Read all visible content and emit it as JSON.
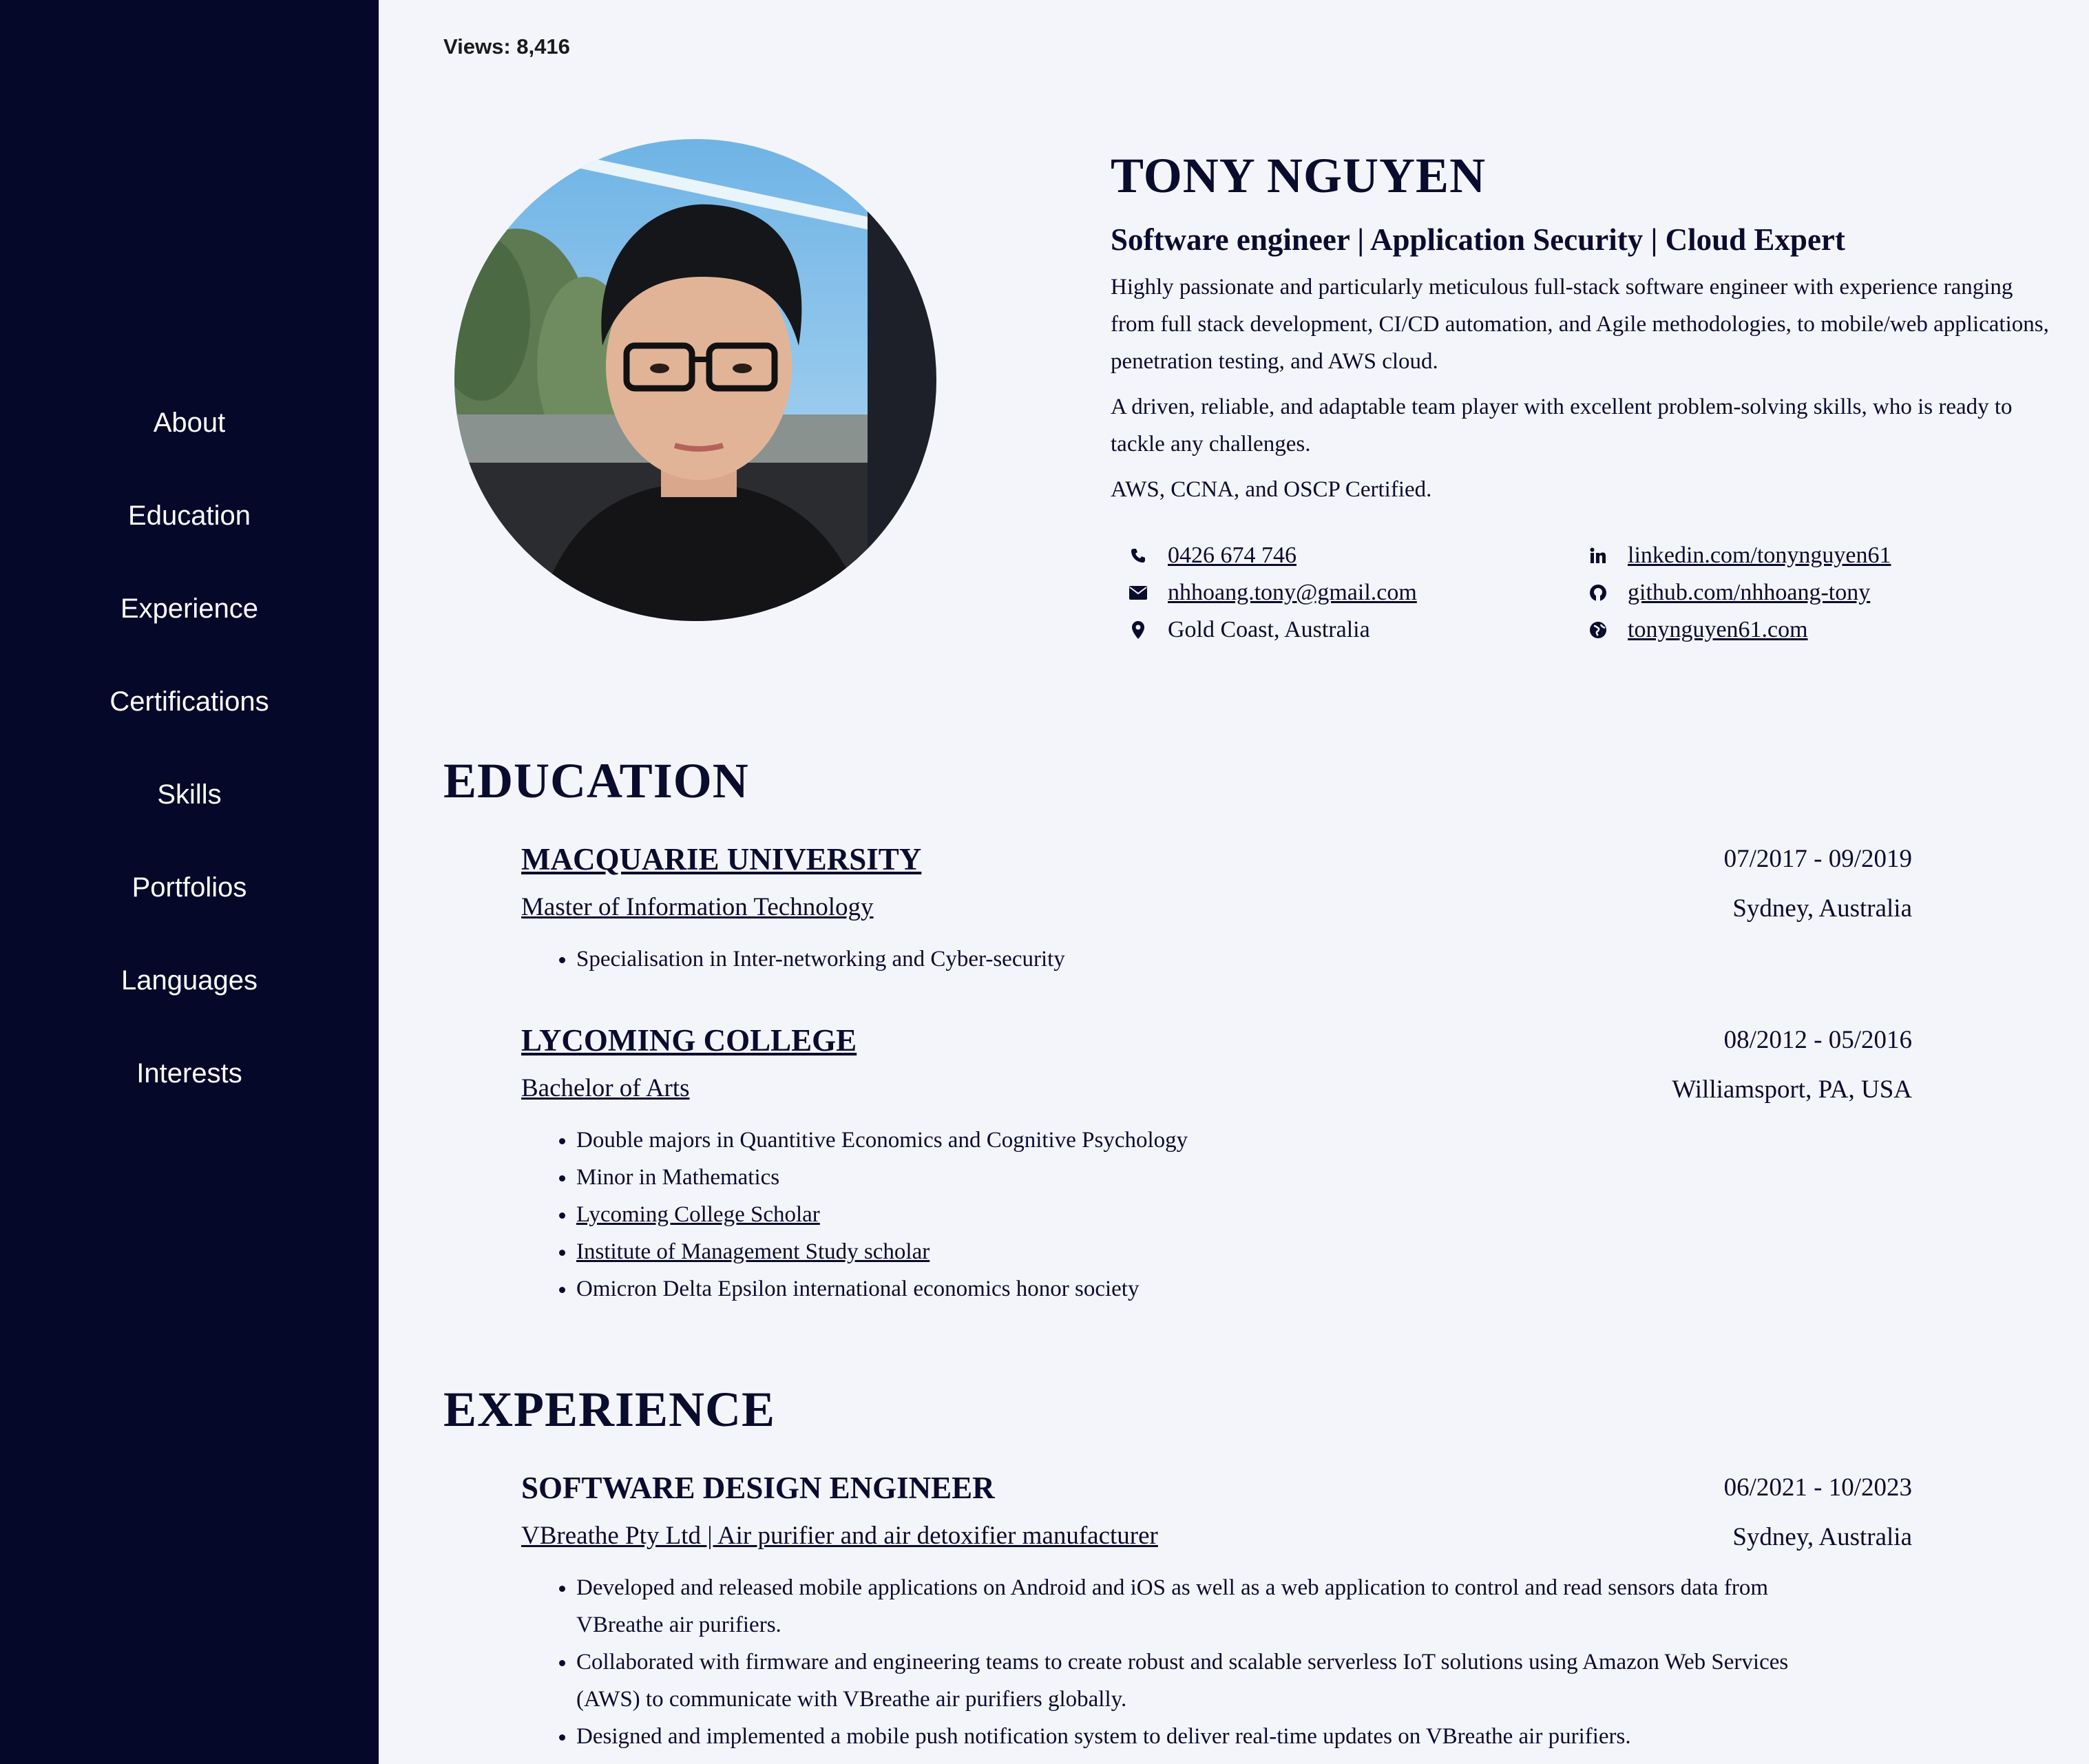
{
  "views": "Views: 8,416",
  "nav": [
    "About",
    "Education",
    "Experience",
    "Certifications",
    "Skills",
    "Portfolios",
    "Languages",
    "Interests"
  ],
  "profile": {
    "name": "TONY NGUYEN",
    "headline": "Software engineer | Application Security | Cloud Expert",
    "summary": [
      "Highly passionate and particularly meticulous full-stack software engineer with experience ranging from full stack development, CI/CD automation, and Agile methodologies, to mobile/web applications, penetration testing, and AWS cloud.",
      "A driven, reliable, and adaptable team player with excellent problem-solving skills, who is ready to tackle any challenges.",
      "AWS, CCNA, and OSCP Certified."
    ],
    "contacts": {
      "phone": "0426 674 746",
      "email": "nhhoang.tony@gmail.com",
      "location": "Gold Coast, Australia",
      "linkedin": "linkedin.com/tonynguyen61",
      "github": "github.com/nhhoang-tony",
      "website": "tonynguyen61.com"
    }
  },
  "education": {
    "title": "EDUCATION",
    "entries": [
      {
        "school": "MACQUARIE UNIVERSITY",
        "degree": "Master of Information Technology",
        "dates": "07/2017 - 09/2019",
        "location": "Sydney, Australia",
        "bullets": [
          "Specialisation in Inter-networking and Cyber-security"
        ]
      },
      {
        "school": "LYCOMING COLLEGE",
        "degree": "Bachelor of Arts",
        "dates": "08/2012 - 05/2016",
        "location": "Williamsport, PA, USA",
        "bullets": [
          "Double majors in Quantitive Economics and Cognitive Psychology",
          "Minor in Mathematics",
          "Lycoming College Scholar",
          "Institute of Management Study scholar",
          "Omicron Delta Epsilon international economics honor society"
        ]
      }
    ]
  },
  "experience": {
    "title": "EXPERIENCE",
    "entries": [
      {
        "role": "SOFTWARE DESIGN ENGINEER",
        "company": "VBreathe Pty Ltd | Air purifier and air detoxifier manufacturer",
        "dates": "06/2021 - 10/2023",
        "location": "Sydney, Australia",
        "bullets": [
          "Developed and released mobile applications on Android and iOS as well as a web application to control and read sensors data from VBreathe air purifiers.",
          "Collaborated with firmware and engineering teams to create robust and scalable serverless IoT solutions using Amazon Web Services (AWS) to communicate with VBreathe air purifiers globally.",
          "Designed and implemented a mobile push notification system to deliver real-time updates on VBreathe air purifiers."
        ]
      }
    ]
  },
  "icons": [
    "phone-icon",
    "envelope-icon",
    "map-pin-icon",
    "linkedin-icon",
    "github-icon",
    "globe-icon"
  ]
}
